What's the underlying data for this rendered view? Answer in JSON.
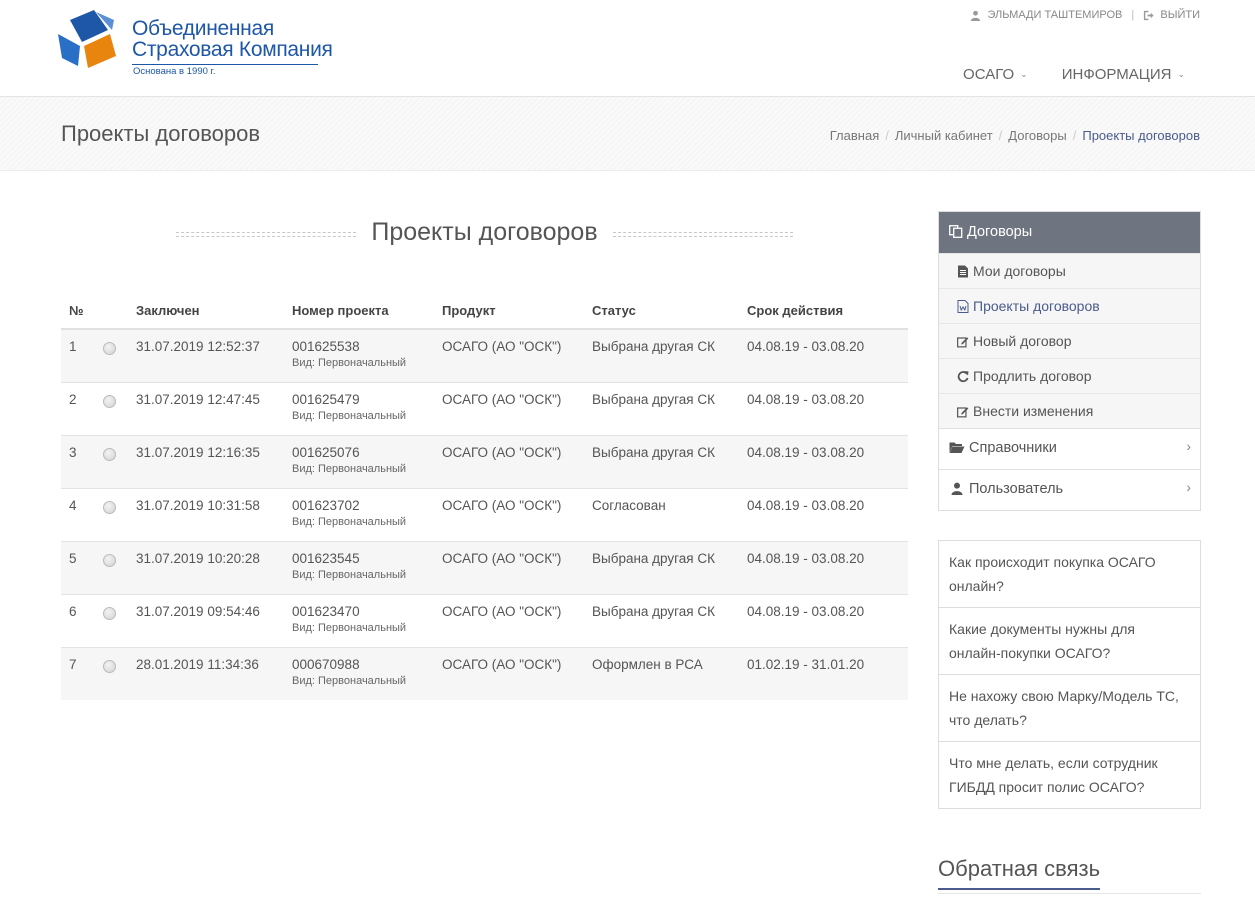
{
  "logo": {
    "line1": "Объединенная",
    "line2": "Страховая Компания",
    "tagline": "Основана в 1990 г."
  },
  "userbar": {
    "user_name": "ЭЛЬМАДИ ТАШТЕМИРОВ",
    "separator": "|",
    "logout_label": "ВЫЙТИ"
  },
  "nav": {
    "items": [
      {
        "label": "ОСАГО",
        "chevron": "⌄"
      },
      {
        "label": "ИНФОРМАЦИЯ",
        "chevron": "⌄"
      }
    ]
  },
  "page": {
    "title": "Проекты договоров",
    "heading": "Проекты договоров"
  },
  "breadcrumb": {
    "items": [
      "Главная",
      "Личный кабинет",
      "Договоры",
      "Проекты договоров"
    ],
    "separator": "/"
  },
  "table": {
    "headers": [
      "№",
      "",
      "Заключен",
      "Номер проекта",
      "Продукт",
      "Статус",
      "Срок действия"
    ],
    "rows": [
      {
        "num": "1",
        "date": "31.07.2019 12:52:37",
        "project": "001625538",
        "kind": "Вид: Первоначальный",
        "product": "ОСАГО (АО \"ОСК\")",
        "status": "Выбрана другая СК",
        "period": "04.08.19 - 03.08.20"
      },
      {
        "num": "2",
        "date": "31.07.2019 12:47:45",
        "project": "001625479",
        "kind": "Вид: Первоначальный",
        "product": "ОСАГО (АО \"ОСК\")",
        "status": "Выбрана другая СК",
        "period": "04.08.19 - 03.08.20"
      },
      {
        "num": "3",
        "date": "31.07.2019 12:16:35",
        "project": "001625076",
        "kind": "Вид: Первоначальный",
        "product": "ОСАГО (АО \"ОСК\")",
        "status": "Выбрана другая СК",
        "period": "04.08.19 - 03.08.20"
      },
      {
        "num": "4",
        "date": "31.07.2019 10:31:58",
        "project": "001623702",
        "kind": "Вид: Первоначальный",
        "product": "ОСАГО (АО \"ОСК\")",
        "status": "Согласован",
        "period": "04.08.19 - 03.08.20"
      },
      {
        "num": "5",
        "date": "31.07.2019 10:20:28",
        "project": "001623545",
        "kind": "Вид: Первоначальный",
        "product": "ОСАГО (АО \"ОСК\")",
        "status": "Выбрана другая СК",
        "period": "04.08.19 - 03.08.20"
      },
      {
        "num": "6",
        "date": "31.07.2019 09:54:46",
        "project": "001623470",
        "kind": "Вид: Первоначальный",
        "product": "ОСАГО (АО \"ОСК\")",
        "status": "Выбрана другая СК",
        "period": "04.08.19 - 03.08.20"
      },
      {
        "num": "7",
        "date": "28.01.2019 11:34:36",
        "project": "000670988",
        "kind": "Вид: Первоначальный",
        "product": "ОСАГО (АО \"ОСК\")",
        "status": "Оформлен в РСА",
        "period": "01.02.19 - 31.01.20"
      }
    ]
  },
  "sidebar": {
    "section_title": "Договоры",
    "section_icon": "copy-icon",
    "sub_items": [
      {
        "label": "Мои договоры",
        "icon": "file-text-icon"
      },
      {
        "label": "Проекты договоров",
        "icon": "file-word-icon",
        "active": true
      },
      {
        "label": "Новый договор",
        "icon": "edit-icon"
      },
      {
        "label": "Продлить договор",
        "icon": "refresh-icon"
      },
      {
        "label": "Внести изменения",
        "icon": "edit-icon"
      }
    ],
    "groups": [
      {
        "label": "Справочники",
        "icon": "folder-open-icon",
        "chevron": "›"
      },
      {
        "label": "Пользователь",
        "icon": "user-icon",
        "chevron": "›"
      }
    ]
  },
  "faq": {
    "items": [
      "Как происходит покупка ОСАГО онлайн?",
      "Какие документы нужны для онлайн-покупки ОСАГО?",
      "Не нахожу свою Марку/Модель ТС, что делать?",
      "Что мне делать, если сотрудник ГИБДД просит полис ОСАГО?"
    ]
  },
  "feedback": {
    "title": "Обратная связь"
  },
  "colors": {
    "brand_blue": "#1e57a8",
    "brand_orange": "#e8850f",
    "accent": "#4a5c8c",
    "sidebar_header": "#6f7580"
  }
}
